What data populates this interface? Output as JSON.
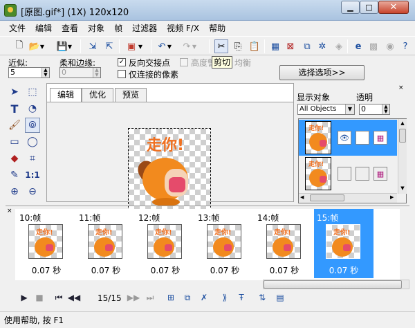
{
  "window": {
    "title": "[原图.gif*] (1X) 120x120"
  },
  "menu": [
    "文件",
    "编辑",
    "查看",
    "对象",
    "帧",
    "过滤器",
    "视频 F/X",
    "帮助"
  ],
  "toolbar": {
    "icons": [
      "new-icon",
      "open-icon",
      "save-icon",
      "import-icon",
      "export-icon",
      "color-icon",
      "undo-icon",
      "redo-icon",
      "cut-icon",
      "copy-icon",
      "paste-icon",
      "frame-add-icon",
      "frame-delete-icon",
      "crop-icon",
      "object-icon",
      "ie-preview-icon",
      "ns-preview-icon",
      "help-icon"
    ]
  },
  "options": {
    "similar_label": "近似:",
    "similar_value": "5",
    "soft_label": "柔和边缘:",
    "soft_value": "0",
    "reverse_label": "反向交接点",
    "reverse_checked": true,
    "connect_label": "仅连接的像素",
    "connect_checked": false,
    "highlight_label": "高度警戒",
    "balance_label": "均衡",
    "select_button": "选择选项>>"
  },
  "tooltip": "剪切",
  "tabs": [
    "编辑",
    "优化",
    "预览"
  ],
  "image": {
    "text": "走你!"
  },
  "right_panel": {
    "display_label": "显示对象",
    "opacity_label": "透明",
    "object_select": "All Objects",
    "opacity_value": "0"
  },
  "frames": [
    {
      "label": "10:帧",
      "delay": "0.07 秒"
    },
    {
      "label": "11:帧",
      "delay": "0.07 秒"
    },
    {
      "label": "12:帧",
      "delay": "0.07 秒"
    },
    {
      "label": "13:帧",
      "delay": "0.07 秒"
    },
    {
      "label": "14:帧",
      "delay": "0.07 秒"
    },
    {
      "label": "15:帧",
      "delay": "0.07 秒"
    }
  ],
  "frame_counter": "15/15",
  "status": "使用帮助, 按 F1",
  "colors": {
    "selection": "#3399ff",
    "accent_orange": "#f07020"
  }
}
